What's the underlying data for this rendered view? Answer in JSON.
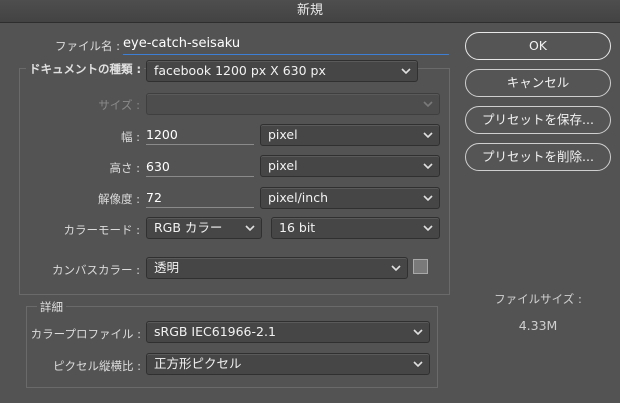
{
  "window": {
    "title": "新規"
  },
  "file": {
    "label": "ファイル名 :",
    "value": "eye-catch-seisaku"
  },
  "doc_type": {
    "label": "ドキュメントの種類 :",
    "value": "facebook 1200 px X 630 px"
  },
  "size": {
    "label": "サイズ :",
    "value": ""
  },
  "width": {
    "label": "幅 :",
    "value": "1200",
    "unit": "pixel"
  },
  "height": {
    "label": "高さ :",
    "value": "630",
    "unit": "pixel"
  },
  "resolution": {
    "label": "解像度 :",
    "value": "72",
    "unit": "pixel/inch"
  },
  "color_mode": {
    "label": "カラーモード :",
    "mode": "RGB カラー",
    "depth": "16 bit"
  },
  "canvas": {
    "label": "カンバスカラー :",
    "value": "透明"
  },
  "details": {
    "title": "詳細",
    "profile_label": "カラープロファイル :",
    "profile_value": "sRGB IEC61966-2.1",
    "pixel_ratio_label": "ピクセル縦横比 :",
    "pixel_ratio_value": "正方形ピクセル"
  },
  "buttons": {
    "ok": "OK",
    "cancel": "キャンセル",
    "save_preset": "プリセットを保存...",
    "delete_preset": "プリセットを削除..."
  },
  "file_size": {
    "label": "ファイルサイズ :",
    "value": "4.33M"
  },
  "colors": {
    "background": "#535353",
    "focus": "#3d7fd6"
  }
}
